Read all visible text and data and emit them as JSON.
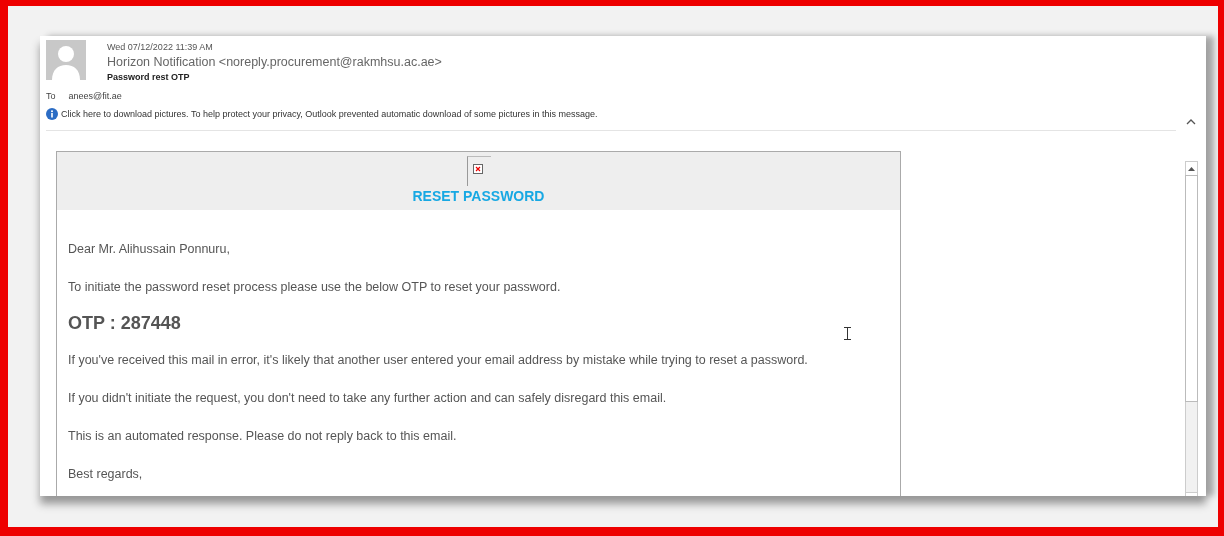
{
  "header": {
    "date": "Wed 07/12/2022 11:39 AM",
    "sender": "Horizon Notification <noreply.procurement@rakmhsu.ac.ae>",
    "subject": "Password rest OTP",
    "to_label": "To",
    "to": "anees@fit.ae",
    "info": "Click here to download pictures. To help protect your privacy, Outlook prevented automatic download of some pictures in this message."
  },
  "message": {
    "title": "RESET PASSWORD",
    "blocks": [
      {
        "kind": "text",
        "text": "Dear Mr. Alihussain Ponnuru,"
      },
      {
        "kind": "text",
        "text": "To initiate the password reset process please use the below OTP to reset your password."
      },
      {
        "kind": "otp",
        "text": "OTP : 287448"
      },
      {
        "kind": "text",
        "text": "If you've received this mail in error, it's likely that another user entered your email address by mistake while trying to reset a password."
      },
      {
        "kind": "text",
        "text": "If you didn't initiate the request, you don't need to take any further action and can safely disregard this email."
      },
      {
        "kind": "text",
        "text": "This is an automated response. Please do not reply back to this email."
      },
      {
        "kind": "text",
        "text": "Best regards,"
      }
    ]
  }
}
